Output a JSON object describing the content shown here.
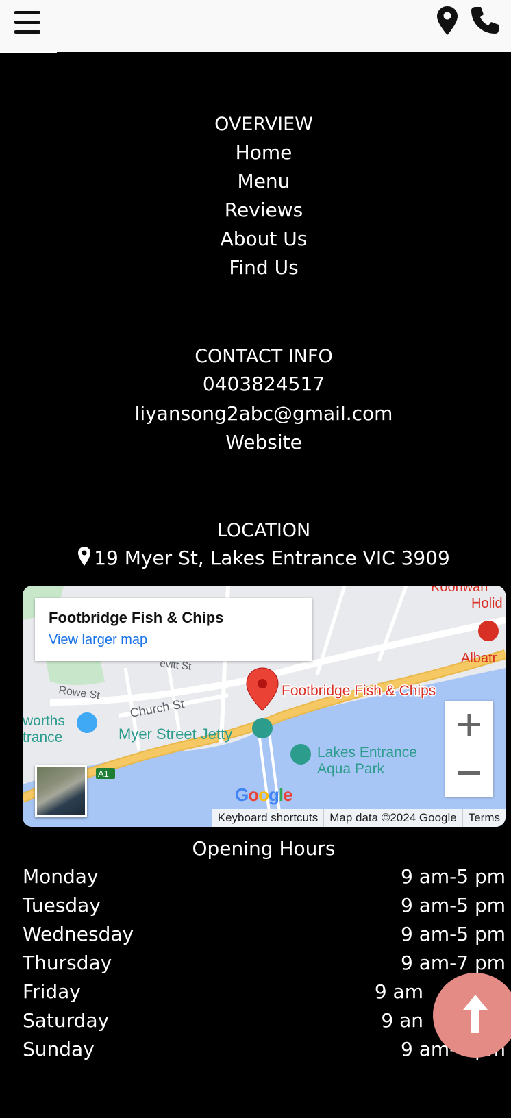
{
  "header": {
    "menu_icon": "hamburger-menu-icon",
    "location_icon": "map-pin-icon",
    "phone_icon": "phone-icon"
  },
  "overview": {
    "title": "OVERVIEW",
    "links": [
      "Home",
      "Menu",
      "Reviews",
      "About Us",
      "Find Us"
    ]
  },
  "contact": {
    "title": "CONTACT INFO",
    "phone": "0403824517",
    "email": "liyansong2abc@gmail.com",
    "website": "Website"
  },
  "location": {
    "title": "LOCATION",
    "address": "19 Myer St, Lakes Entrance VIC 3909"
  },
  "map": {
    "place_name": "Footbridge Fish & Chips",
    "larger_map_link": "View larger map",
    "labels": [
      "Rowe St",
      "Church St",
      "Myer Street Jetty",
      "Lakes Entrance",
      "Aqua Park",
      "Footbridge Fish & Chips",
      "worths",
      "trance",
      "A1",
      "Albatr",
      "Koonwarr",
      "Holid",
      "evitt St"
    ],
    "footer": [
      "Keyboard shortcuts",
      "Map data ©2024 Google",
      "Terms"
    ],
    "logo": "Google",
    "colors": {
      "water": "#a8c6f5",
      "road": "#f6c864",
      "park": "#c8e6c9",
      "marker": "#ea4335"
    }
  },
  "hours": {
    "title": "Opening Hours",
    "days": [
      {
        "day": "Monday",
        "time": "9 am-5 pm"
      },
      {
        "day": "Tuesday",
        "time": "9 am-5 pm"
      },
      {
        "day": "Wednesday",
        "time": "9 am-5 pm"
      },
      {
        "day": "Thursday",
        "time": "9 am-7 pm"
      },
      {
        "day": "Friday",
        "time": "9 am"
      },
      {
        "day": "Saturday",
        "time": "9 an"
      },
      {
        "day": "Sunday",
        "time": "9 am-4 pm"
      }
    ]
  },
  "scroll_top": {
    "icon": "arrow-up-icon",
    "color": "#e48b86"
  }
}
